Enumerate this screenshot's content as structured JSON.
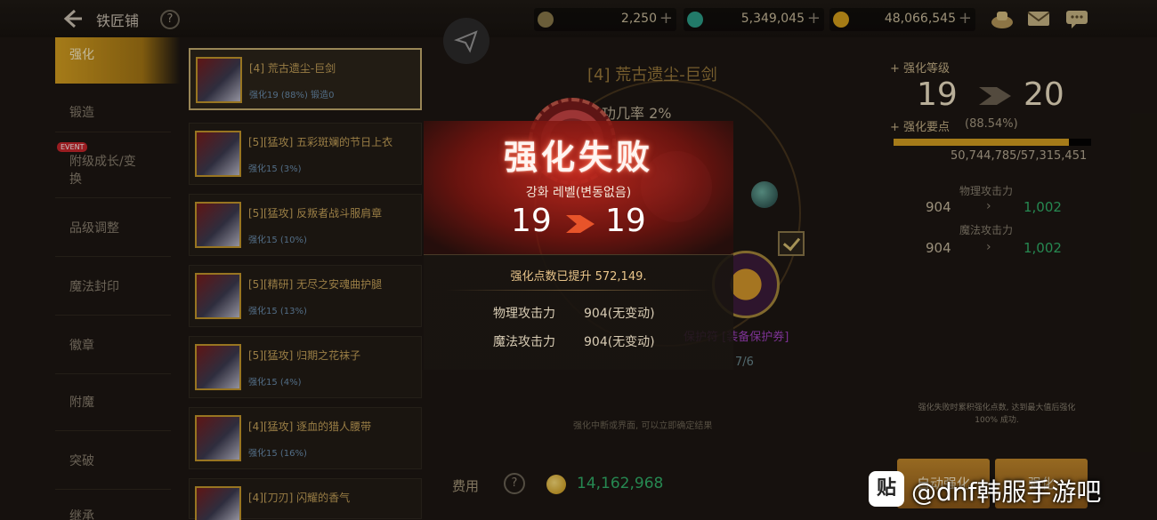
{
  "header": {
    "back_icon": "arrow-left-icon",
    "title": "铁匠铺",
    "help": "?",
    "currencies": [
      {
        "icon": "crescent-coin-icon",
        "amount": "2,250",
        "plus": "+"
      },
      {
        "icon": "green-gem-icon",
        "amount": "5,349,045",
        "plus": "+"
      },
      {
        "icon": "gold-coin-icon",
        "amount": "48,066,545",
        "plus": "+"
      }
    ],
    "right_icons": [
      "treasure-icon",
      "mail-icon",
      "chat-icon"
    ]
  },
  "sidebar": {
    "event_badge": "EVENT",
    "items": [
      {
        "label": "强化"
      },
      {
        "label": "锻造"
      },
      {
        "label": "附级成长/变换"
      },
      {
        "label": "品级调整"
      },
      {
        "label": "魔法封印"
      },
      {
        "label": "徽章"
      },
      {
        "label": "附魔"
      },
      {
        "label": "突破"
      },
      {
        "label": "继承"
      }
    ]
  },
  "item_list": [
    {
      "name": "[4] 荒古遗尘-巨剑",
      "sub": "强化19 (88%) 锻造0"
    },
    {
      "name": "[5][猛攻] 五彩斑斓的节日上衣",
      "sub": "强化15 (3%)"
    },
    {
      "name": "[5][猛攻] 反叛者战斗服肩章",
      "sub": "强化15 (10%)"
    },
    {
      "name": "[5][精研] 无尽之安魂曲护腿",
      "sub": "强化15 (13%)"
    },
    {
      "name": "[5][猛攻] 归期之花袜子",
      "sub": "强化15 (4%)"
    },
    {
      "name": "[4][猛攻] 逐血的猎人腰带",
      "sub": "强化15 (16%)"
    },
    {
      "name": "[4][刀刃] 闪耀的香气",
      "sub": ""
    }
  ],
  "center": {
    "item_title": "[4] 荒古遗尘-巨剑",
    "success_rate": "成功几率 2%",
    "scroll_name": "保护符 [装备保护券]",
    "scroll_count": "7/6",
    "hint": "强化中断或界面, 可以立即确定结果"
  },
  "right_panel": {
    "level_label": "强化等级",
    "level_from": "19",
    "level_to": "20",
    "points_label": "强化要点",
    "points_pct": "(88.54%)",
    "points_progress": 0.8854,
    "points_value": "50,744,785/57,315,451",
    "stats": [
      {
        "label": "物理攻击力",
        "from": "904",
        "to": "1,002"
      },
      {
        "label": "魔法攻击力",
        "from": "904",
        "to": "1,002"
      }
    ],
    "hint": "强化失败时累积强化点数, 达到最大值后强化 100% 成功.",
    "btn_auto": "自动强化",
    "btn_enhance": "强化"
  },
  "cost": {
    "label": "费用",
    "help": "?",
    "value": "14,162,968"
  },
  "popup": {
    "title": "强化失败",
    "subtitle": "강화 레벨(변동없음)",
    "from": "19",
    "to": "19",
    "points_msg": "强化点数已提升 572,149.",
    "rows": [
      {
        "label": "物理攻击力",
        "value": "904(无变动)"
      },
      {
        "label": "魔法攻击力",
        "value": "904(无变动)"
      }
    ]
  },
  "watermark": {
    "logo": "贴",
    "text": "@dnf韩服手游吧"
  },
  "colors": {
    "accent_gold": "#d9a21f",
    "popup_red": "#be281e",
    "stat_green": "#2fb36a"
  }
}
